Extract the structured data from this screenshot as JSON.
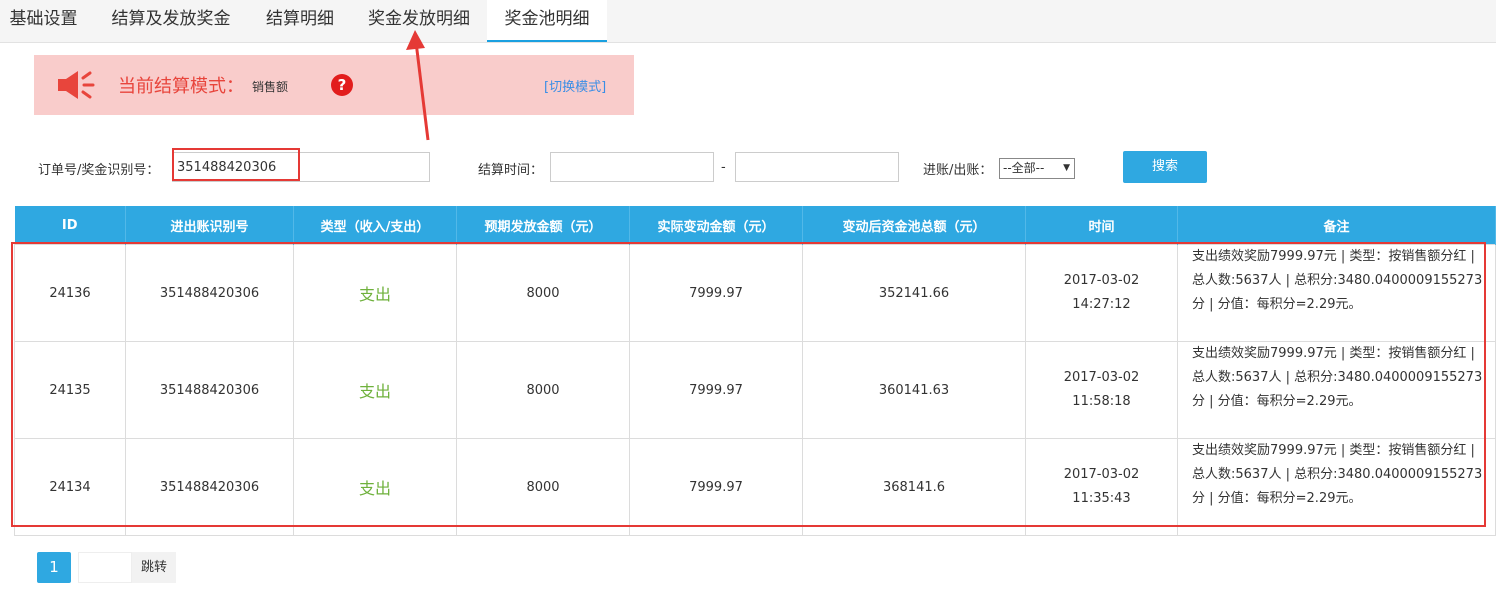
{
  "tabs": [
    {
      "label": "基础设置"
    },
    {
      "label": "结算及发放奖金"
    },
    {
      "label": "结算明细"
    },
    {
      "label": "奖金发放明细"
    },
    {
      "label": "奖金池明细"
    }
  ],
  "active_tab": "奖金池明细",
  "mode": {
    "label": "当前结算模式：",
    "value": "销售额",
    "help": "?",
    "switch_link": "[切换模式]"
  },
  "filters": {
    "order_label": "订单号/奖金识别号：",
    "order_value": "351488420306",
    "time_label": "结算时间：",
    "time_start": "",
    "time_sep": "-",
    "time_end": "",
    "inout_label": "进账/出账：",
    "inout_selected": "--全部--",
    "search_label": "搜索"
  },
  "table": {
    "headers": [
      "ID",
      "进出账识别号",
      "类型（收入/支出）",
      "预期发放金额（元）",
      "实际变动金额（元）",
      "变动后资金池总额（元）",
      "时间",
      "备注"
    ],
    "rows": [
      {
        "id": "24136",
        "code": "351488420306",
        "type": "支出",
        "expected": "8000",
        "actual": "7999.97",
        "pool": "352141.66",
        "date": "2017-03-02",
        "time": "14:27:12",
        "remark": "支出绩效奖励7999.97元 | 类型：按销售额分红 | 总人数:5637人 | 总积分:3480.0400009155273分 | 分值：每积分=2.29元。"
      },
      {
        "id": "24135",
        "code": "351488420306",
        "type": "支出",
        "expected": "8000",
        "actual": "7999.97",
        "pool": "360141.63",
        "date": "2017-03-02",
        "time": "11:58:18",
        "remark": "支出绩效奖励7999.97元 | 类型：按销售额分红 | 总人数:5637人 | 总积分:3480.0400009155273分 | 分值：每积分=2.29元。"
      },
      {
        "id": "24134",
        "code": "351488420306",
        "type": "支出",
        "expected": "8000",
        "actual": "7999.97",
        "pool": "368141.6",
        "date": "2017-03-02",
        "time": "11:35:43",
        "remark": "支出绩效奖励7999.97元 | 类型：按销售额分红 | 总人数:5637人 | 总积分:3480.0400009155273分 | 分值：每积分=2.29元。"
      }
    ]
  },
  "pagination": {
    "current": "1",
    "go_label": "跳转"
  },
  "colors": {
    "accent": "#2fa8e1",
    "alert_bg": "#f9cccb",
    "alert_text": "#e8453c",
    "expense_text": "#6fb13c",
    "annotation": "#e53935"
  }
}
